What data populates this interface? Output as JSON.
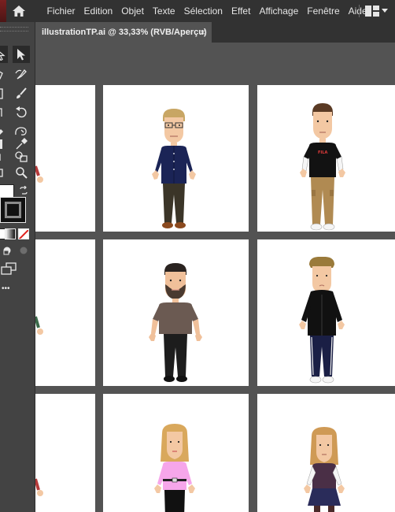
{
  "menubar": {
    "items": [
      "Fichier",
      "Edition",
      "Objet",
      "Texte",
      "Sélection",
      "Effet",
      "Affichage",
      "Fenêtre",
      "Aide"
    ],
    "home_icon": "home-icon",
    "workspace_icon": "workspace-switcher-icon"
  },
  "document": {
    "tab_title": "illustrationTP.ai @ 33,33% (RVB/Aperçu)",
    "close_symbol": "×"
  },
  "toolbar": {
    "tools": [
      "selection-tool",
      "direct-selection-tool",
      "pen-tool",
      "curvature-tool",
      "line-tool",
      "paintbrush-tool",
      "rotate-tool",
      "reflect-tool",
      "eraser-tool",
      "warp-tool",
      "eyedropper-tool",
      "shape-builder-tool",
      "zoom-tool",
      "hand-tool",
      "swap-colors",
      "fill-swatch",
      "stroke-swatch",
      "color-mode",
      "gradient-mode",
      "none-mode",
      "draw-mode",
      "screen-mode",
      "more-tools"
    ],
    "more_label": "•••"
  },
  "artboards": [
    {
      "row": 1,
      "col": 0,
      "figure": "partial-red-arm"
    },
    {
      "row": 1,
      "col": 1,
      "figure": "blond-man-glasses-navy-shirt"
    },
    {
      "row": 1,
      "col": 2,
      "figure": "brown-hair-man-black-tshirt-khaki-pants"
    },
    {
      "row": 2,
      "col": 0,
      "figure": "partial-green-arm"
    },
    {
      "row": 2,
      "col": 1,
      "figure": "bearded-man-brown-tshirt-black-pants"
    },
    {
      "row": 2,
      "col": 2,
      "figure": "man-black-jacket-navy-pants"
    },
    {
      "row": 3,
      "col": 0,
      "figure": "partial-red-arm"
    },
    {
      "row": 3,
      "col": 1,
      "figure": "blonde-woman-pink-top"
    },
    {
      "row": 3,
      "col": 2,
      "figure": "blonde-woman-purple-top-navy-skirt"
    }
  ],
  "colors": {
    "ui_dark": "#323232",
    "ui_panel": "#434343",
    "canvas": "#535353",
    "artboard": "#ffffff",
    "skin": "#f3c8a3"
  }
}
